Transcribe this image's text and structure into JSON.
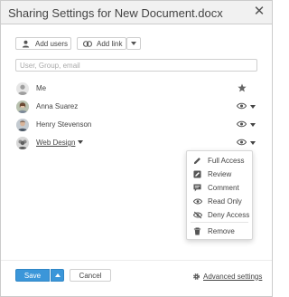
{
  "dialog": {
    "title": "Sharing Settings for New Document.docx",
    "close_glyph": "✕"
  },
  "toolbar": {
    "add_users_label": "Add users",
    "add_link_label": "Add link"
  },
  "search": {
    "placeholder": "User, Group, email",
    "value": ""
  },
  "users": [
    {
      "name": "Me",
      "avatar": "default-avatar",
      "access_icon": "star-icon",
      "has_caret": false
    },
    {
      "name": "Anna Suarez",
      "avatar": "photo-avatar",
      "access_icon": "eye-icon",
      "has_caret": true
    },
    {
      "name": "Henry Stevenson",
      "avatar": "photo-avatar",
      "access_icon": "eye-icon",
      "has_caret": true
    },
    {
      "name": "Web Design",
      "avatar": "group-avatar",
      "access_icon": "eye-icon",
      "has_caret": true,
      "is_group": true
    }
  ],
  "access_menu": {
    "items": [
      {
        "label": "Full Access",
        "icon": "pencil-icon"
      },
      {
        "label": "Review",
        "icon": "review-icon"
      },
      {
        "label": "Comment",
        "icon": "comment-icon"
      },
      {
        "label": "Read Only",
        "icon": "eye-icon"
      },
      {
        "label": "Deny Access",
        "icon": "eye-slash-icon"
      },
      {
        "label": "Remove",
        "icon": "trash-icon"
      }
    ]
  },
  "footer": {
    "save_label": "Save",
    "cancel_label": "Cancel",
    "advanced_label": "Advanced settings"
  },
  "colors": {
    "accent": "#3b96d9",
    "title_bar": "#f1f1f1",
    "border": "#cbcbcb",
    "text": "#444444"
  }
}
